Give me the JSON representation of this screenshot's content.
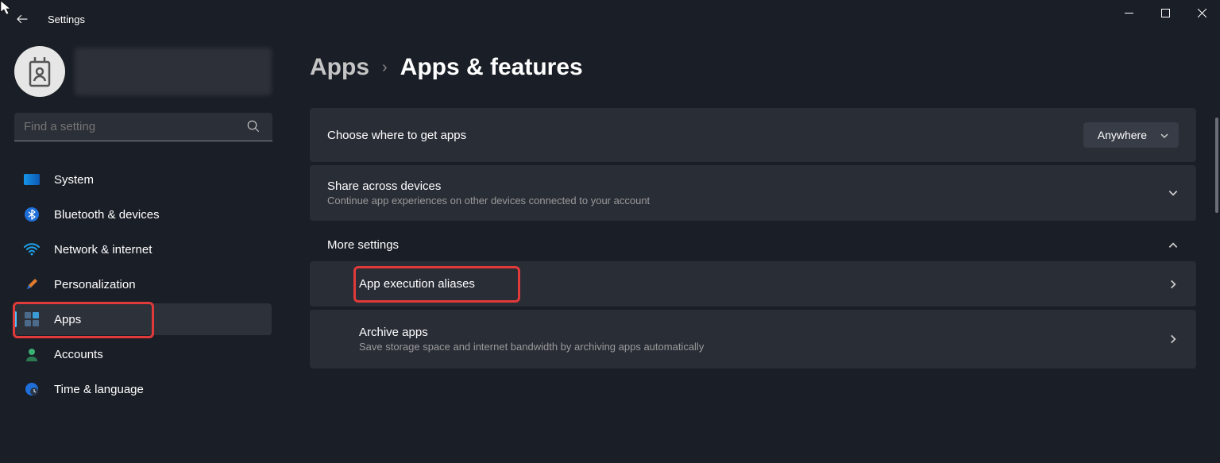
{
  "window": {
    "title": "Settings"
  },
  "search": {
    "placeholder": "Find a setting"
  },
  "nav": {
    "items": [
      {
        "label": "System"
      },
      {
        "label": "Bluetooth & devices"
      },
      {
        "label": "Network & internet"
      },
      {
        "label": "Personalization"
      },
      {
        "label": "Apps"
      },
      {
        "label": "Accounts"
      },
      {
        "label": "Time & language"
      }
    ]
  },
  "breadcrumb": {
    "parent": "Apps",
    "current": "Apps & features"
  },
  "cards": {
    "getApps": {
      "title": "Choose where to get apps",
      "dropdown": "Anywhere"
    },
    "share": {
      "title": "Share across devices",
      "sub": "Continue app experiences on other devices connected to your account"
    },
    "moreSettings": "More settings",
    "execAliases": {
      "title": "App execution aliases"
    },
    "archive": {
      "title": "Archive apps",
      "sub": "Save storage space and internet bandwidth by archiving apps automatically"
    }
  }
}
